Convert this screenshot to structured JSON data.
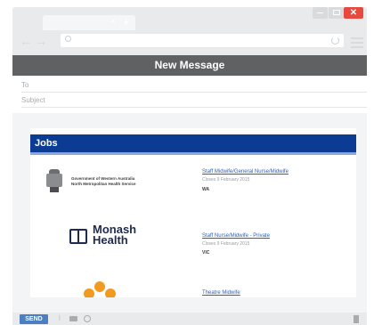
{
  "browser": {
    "tab_close": "×",
    "new_tab": "+",
    "window_close": "✕",
    "nav_back": "←",
    "nav_forward": "→",
    "colors": {
      "chrome": "#e9eaec",
      "close": "#e64a3f",
      "header": "#5f6163"
    }
  },
  "compose": {
    "title": "New Message",
    "to_label": "To",
    "subject_label": "Subject"
  },
  "email": {
    "banner_title": "Jobs",
    "banner_color": "#0c3b94",
    "jobs": [
      {
        "logo_text": "Government of Western Australia\nNorth Metropolitan Health Service",
        "title": "Staff Midwife/General Nurse/Midwife",
        "meta": "Closes 9 February 2015",
        "location": "WA"
      },
      {
        "logo_text": "Monash\nHealth",
        "title": "Staff Nurse/Midwife - Private",
        "meta": "Closes 9 February 2015",
        "location": "VIC"
      },
      {
        "logo_text": "",
        "title": "Theatre Midwife",
        "meta": "",
        "location": ""
      }
    ]
  },
  "footer": {
    "send_label": "SEND",
    "attach_glyph": "⦚",
    "icons": [
      "attach-icon",
      "camera-icon",
      "emoji-icon",
      "trash-icon"
    ]
  }
}
